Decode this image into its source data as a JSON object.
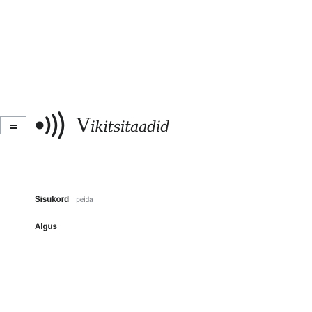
{
  "header": {
    "menu_icon": "hamburger-menu-icon",
    "logo_icon": "broadcast-dot-icon",
    "wordmark_initial": "V",
    "wordmark_rest": "ikitsitaadid"
  },
  "toc": {
    "title": "Sisukord",
    "hide_label": "peida",
    "items": [
      {
        "label": "Algus"
      }
    ]
  }
}
